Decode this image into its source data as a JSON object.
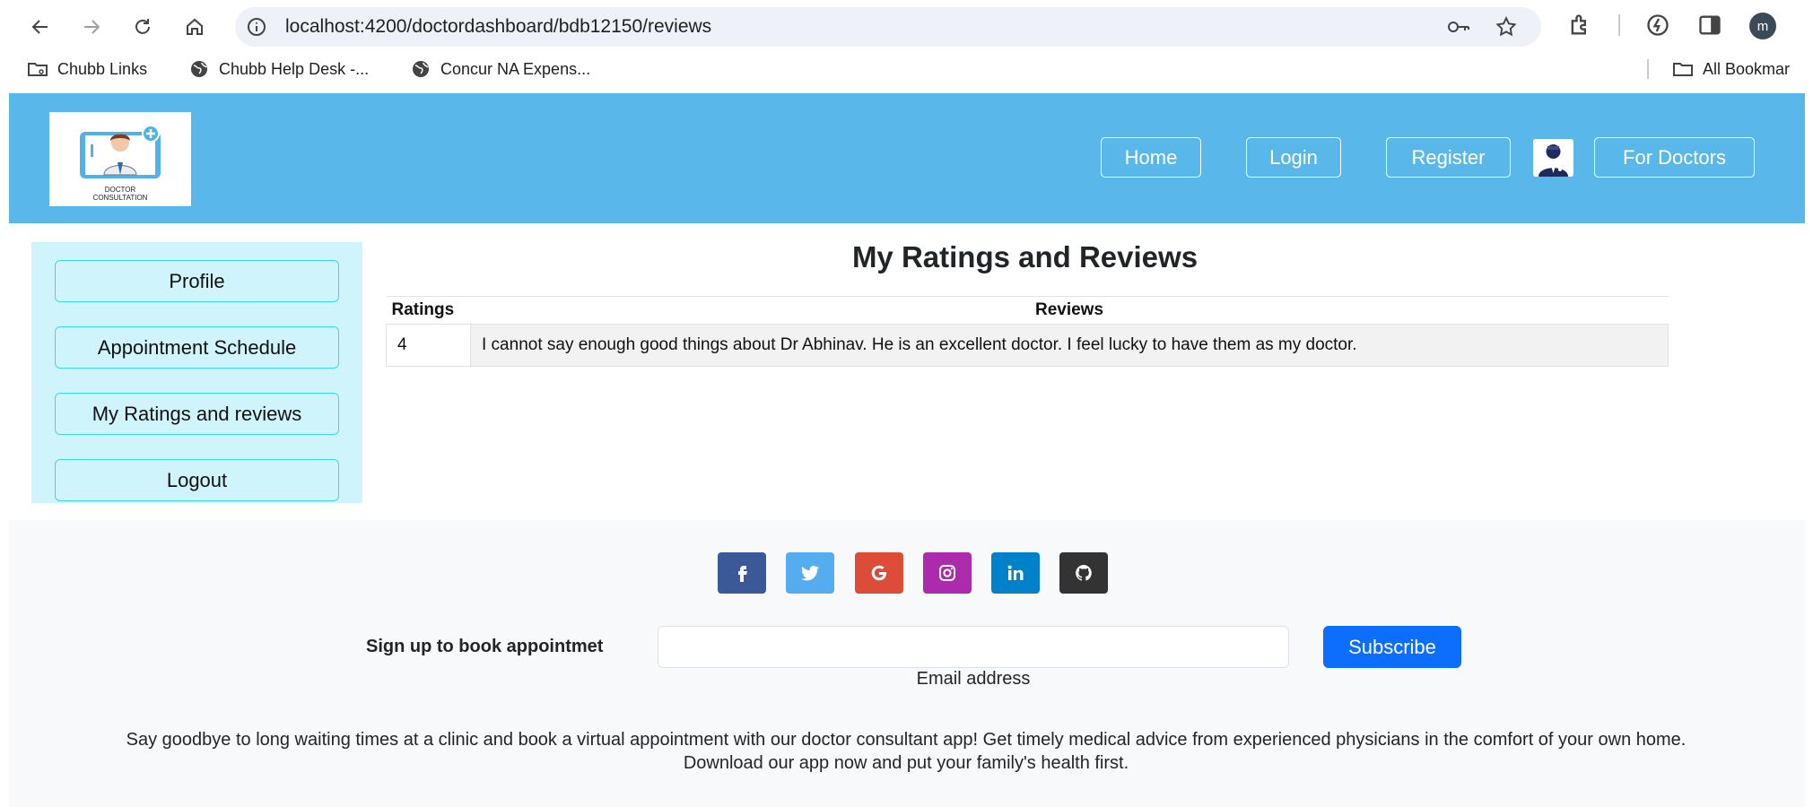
{
  "browser": {
    "url": "localhost:4200/doctordashboard/bdb12150/reviews",
    "profile_initial": "m",
    "bookmarks": [
      {
        "label": "Chubb Links",
        "icon": "folder-icon"
      },
      {
        "label": "Chubb Help Desk -...",
        "icon": "globe-icon"
      },
      {
        "label": "Concur NA Expens...",
        "icon": "globe-icon"
      }
    ],
    "all_bookmarks": "All Bookmar"
  },
  "header": {
    "logo_text_line1": "DOCTOR",
    "logo_text_line2": "CONSULTATION",
    "nav": {
      "home": "Home",
      "login": "Login",
      "register": "Register",
      "for_doctors": "For Doctors"
    },
    "colors": {
      "header_bg": "#5ab7ea"
    }
  },
  "sidebar": {
    "items": [
      {
        "label": "Profile"
      },
      {
        "label": "Appointment Schedule"
      },
      {
        "label": "My Ratings and reviews"
      },
      {
        "label": "Logout"
      }
    ]
  },
  "main": {
    "title": "My Ratings and Reviews",
    "table": {
      "headers": [
        "Ratings",
        "Reviews"
      ],
      "rows": [
        {
          "rating": "4",
          "review": "I cannot say enough good things about Dr Abhinav. He is an excellent doctor. I feel lucky to have them as my doctor."
        }
      ]
    }
  },
  "footer": {
    "social": [
      {
        "icon": "facebook-icon",
        "color": "#3b5998"
      },
      {
        "icon": "twitter-icon",
        "color": "#55acee"
      },
      {
        "icon": "google-icon",
        "color": "#dd4b39"
      },
      {
        "icon": "instagram-icon",
        "color": "#ac2bac"
      },
      {
        "icon": "linkedin-icon",
        "color": "#0082ca"
      },
      {
        "icon": "github-icon",
        "color": "#333333"
      }
    ],
    "signup_label": "Sign up to book appointmet",
    "email_label": "Email address",
    "email_placeholder": "",
    "subscribe_label": "Subscribe",
    "tagline": "Say goodbye to long waiting times at a clinic and book a virtual appointment with our doctor consultant app! Get timely medical advice from experienced physicians in the comfort of your own home. Download our app now and put your family's health first."
  }
}
